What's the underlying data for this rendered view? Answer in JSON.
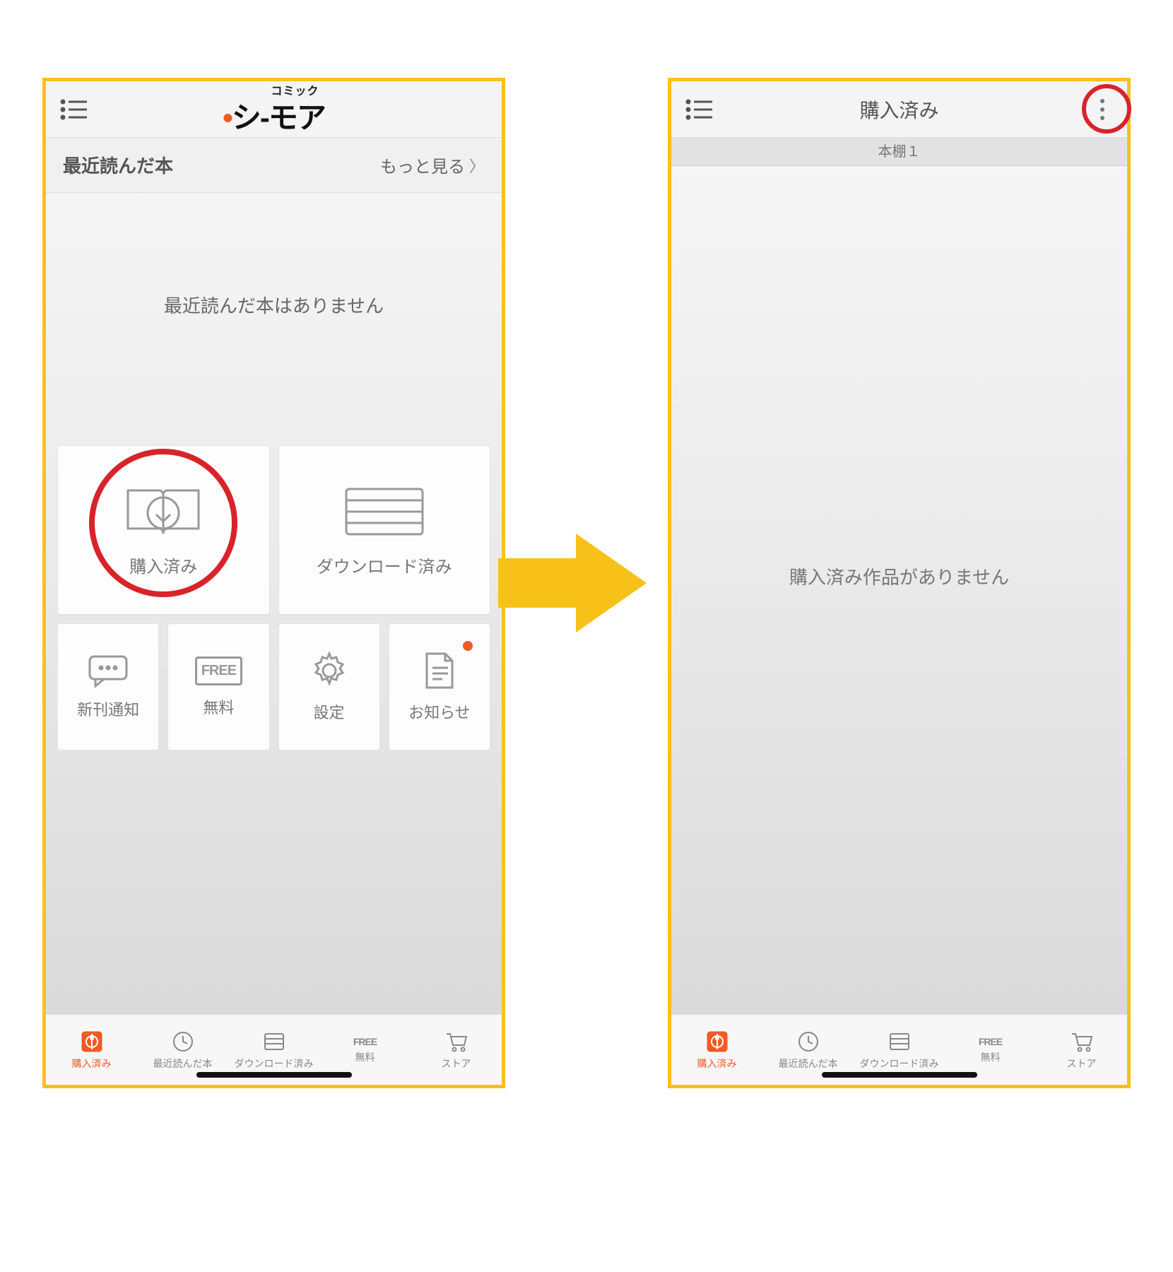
{
  "left": {
    "logo_small": "コミック",
    "logo_main_pre": "シ",
    "logo_main_post": "-モア",
    "section_title": "最近読んだ本",
    "more_link": "もっと見る",
    "empty_recent": "最近読んだ本はありません",
    "card_purchased": "購入済み",
    "card_downloaded": "ダウンロード済み",
    "card_new": "新刊通知",
    "card_free": "無料",
    "card_settings": "設定",
    "card_notice": "お知らせ",
    "free_icon_text": "FREE"
  },
  "right": {
    "title": "購入済み",
    "shelf": "本棚１",
    "empty": "購入済み作品がありません"
  },
  "tabs": [
    {
      "label": "購入済み"
    },
    {
      "label": "最近読んだ本"
    },
    {
      "label": "ダウンロード済み"
    },
    {
      "label": "無料",
      "icon_text": "FREE"
    },
    {
      "label": "ストア"
    }
  ]
}
